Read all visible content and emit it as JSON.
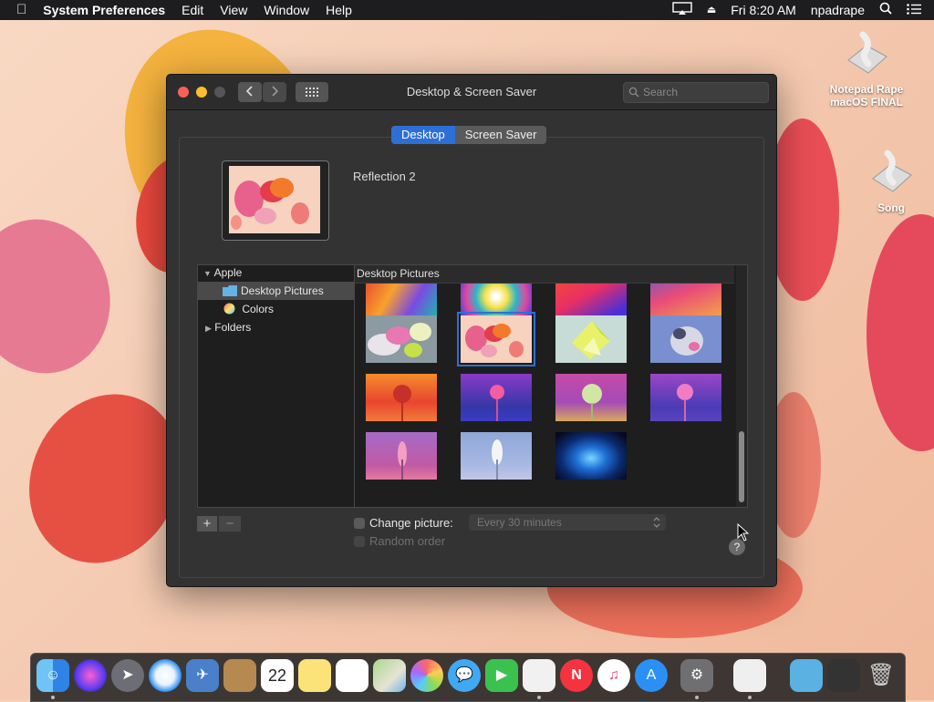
{
  "menubar": {
    "apple_icon": "apple-icon",
    "app_name": "System Preferences",
    "menus": [
      "Edit",
      "View",
      "Window",
      "Help"
    ],
    "clock": "Fri 8:20 AM",
    "user": "npadrape"
  },
  "window": {
    "title": "Desktop & Screen Saver",
    "search_placeholder": "Search",
    "tabs": [
      {
        "label": "Desktop",
        "selected": true
      },
      {
        "label": "Screen Saver",
        "selected": false
      }
    ],
    "selected_picture_name": "Reflection 2",
    "sidebar": {
      "items": [
        {
          "label": "Apple",
          "expanded": true
        },
        {
          "label": "Desktop Pictures",
          "selected": true
        },
        {
          "label": "Colors"
        },
        {
          "label": "Folders",
          "expanded": false
        }
      ]
    },
    "grid_header": "Desktop Pictures",
    "add_label": "+",
    "remove_label": "−",
    "change_picture_label": "Change picture:",
    "change_interval": "Every 30 minutes",
    "random_order_label": "Random order",
    "help_label": "?"
  },
  "desktop_icons": [
    {
      "label": "Notepad Rape macOS FINAL"
    },
    {
      "label": "Song"
    }
  ],
  "colors": {
    "accent": "#2e6fd6",
    "menubar": "#1d1d1f",
    "window": "#323232"
  }
}
